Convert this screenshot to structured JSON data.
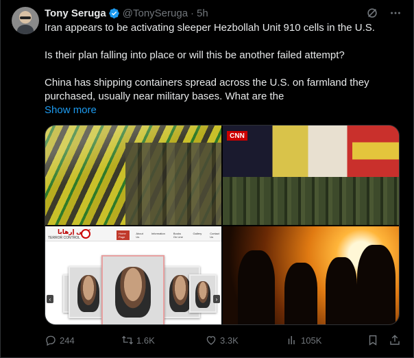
{
  "author": {
    "name": "Tony Seruga",
    "handle": "@TonySeruga",
    "separator": "·",
    "time": "5h",
    "verified_color": "#1d9bf0"
  },
  "tweet": {
    "lines": [
      "Iran appears to be activating sleeper Hezbollah Unit 910 cells in the U.S.",
      "Is their plan falling into place or will this be another failed attempt?",
      "China has shipping containers spread across the U.S. on farmland they",
      "purchased, usually near military bases. What are the"
    ],
    "show_more": "Show more"
  },
  "media": {
    "tile2_badge": "CNN",
    "tile3": {
      "site_name": "كفى إرهابا",
      "site_sub": "TERROR CONTROL",
      "nav": [
        "Home Page",
        "About Us",
        "Information",
        "Books On Line",
        "Gallery",
        "Contact Us"
      ]
    }
  },
  "actions": {
    "replies": "244",
    "reposts": "1.6K",
    "likes": "3.3K",
    "views": "105K"
  },
  "icons": {
    "verified": "verified-badge-icon",
    "grok": "grok-icon",
    "more": "more-icon",
    "reply": "reply-icon",
    "repost": "repost-icon",
    "like": "like-icon",
    "views": "views-icon",
    "bookmark": "bookmark-icon",
    "share": "share-icon"
  },
  "colors": {
    "background": "#000000",
    "text": "#e7e9ea",
    "muted": "#71767b",
    "link": "#1d9bf0"
  }
}
